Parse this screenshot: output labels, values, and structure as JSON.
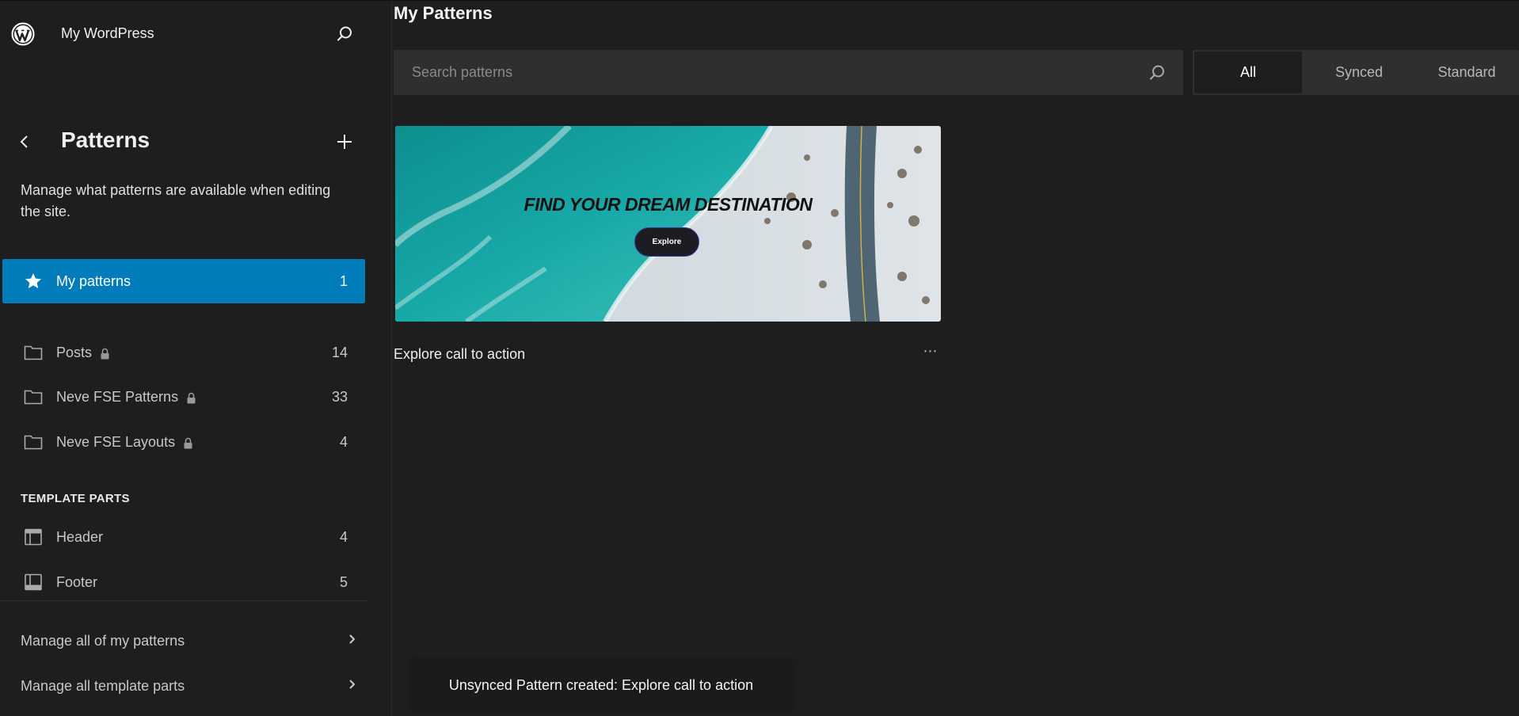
{
  "sidebar": {
    "site_title": "My WordPress",
    "heading": "Patterns",
    "description": "Manage what patterns are available when editing the site.",
    "active_item": {
      "label": "My patterns",
      "count": "1",
      "icon": "star-icon"
    },
    "categories": [
      {
        "label": "Posts",
        "count": "14",
        "locked": true,
        "icon": "folder-icon"
      },
      {
        "label": "Neve FSE Patterns",
        "count": "33",
        "locked": true,
        "icon": "folder-icon"
      },
      {
        "label": "Neve FSE Layouts",
        "count": "4",
        "locked": true,
        "icon": "folder-icon"
      }
    ],
    "template_parts_label": "TEMPLATE PARTS",
    "template_parts": [
      {
        "label": "Header",
        "count": "4",
        "icon": "header-layout-icon"
      },
      {
        "label": "Footer",
        "count": "5",
        "icon": "footer-layout-icon"
      }
    ],
    "footer_links": [
      {
        "label": "Manage all of my patterns"
      },
      {
        "label": "Manage all template parts"
      }
    ]
  },
  "main": {
    "title": "My Patterns",
    "search": {
      "placeholder": "Search patterns",
      "value": ""
    },
    "tabs": [
      {
        "label": "All",
        "active": true
      },
      {
        "label": "Synced",
        "active": false
      },
      {
        "label": "Standard",
        "active": false
      }
    ],
    "patterns": [
      {
        "title": "Explore call to action",
        "preview": {
          "heading": "FIND YOUR DREAM DESTINATION",
          "button_label": "Explore"
        },
        "more_label": "⋯"
      }
    ]
  },
  "toast": {
    "message": "Unsynced Pattern created: Explore call to action"
  },
  "colors": {
    "accent": "#007cba",
    "background": "#1e1e1e",
    "input_bg": "#2f2f2f"
  }
}
